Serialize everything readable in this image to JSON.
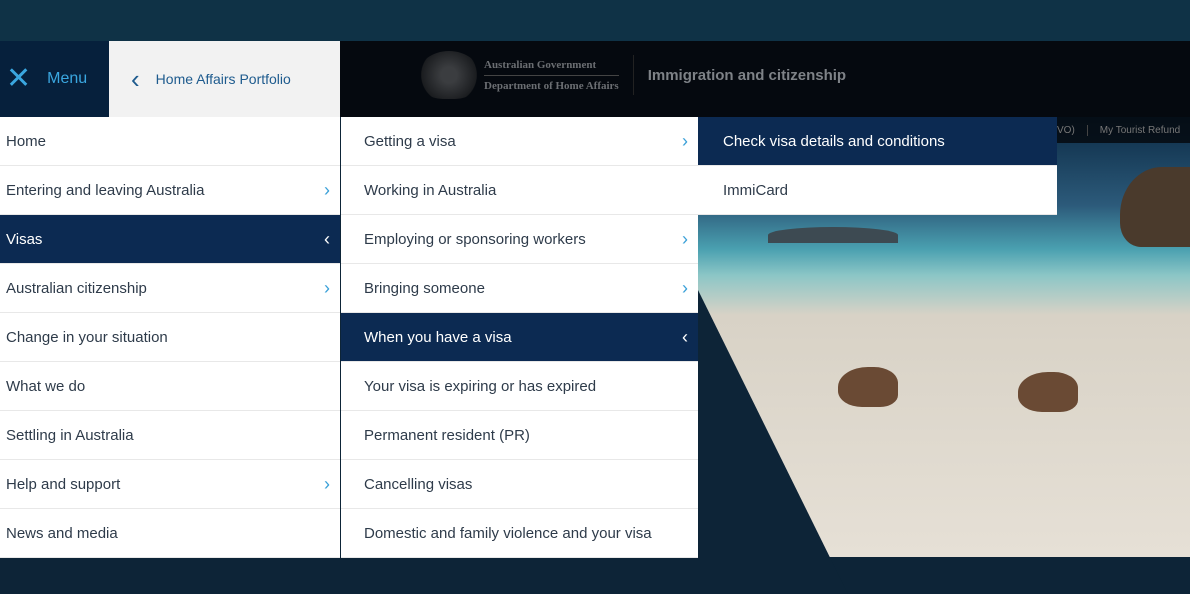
{
  "header": {
    "menu_label": "Menu",
    "portfolio_label": "Home Affairs Portfolio",
    "gov_line1": "Australian Government",
    "gov_line2": "Department of Home Affairs",
    "site_title": "Immigration and citizenship"
  },
  "top_links": [
    "VO)",
    "My Tourist Refund"
  ],
  "col1": [
    {
      "label": "Home",
      "chev": ""
    },
    {
      "label": "Entering and leaving Australia",
      "chev": "›"
    },
    {
      "label": "Visas",
      "chev": "‹",
      "sel": true
    },
    {
      "label": "Australian citizenship",
      "chev": "›"
    },
    {
      "label": "Change in your situation",
      "chev": ""
    },
    {
      "label": "What we do",
      "chev": ""
    },
    {
      "label": "Settling in Australia",
      "chev": ""
    },
    {
      "label": "Help and support",
      "chev": "›"
    },
    {
      "label": "News and media",
      "chev": ""
    }
  ],
  "col2": [
    {
      "label": "Getting a visa",
      "chev": "›"
    },
    {
      "label": "Working in Australia",
      "chev": ""
    },
    {
      "label": "Employing or sponsoring workers",
      "chev": "›"
    },
    {
      "label": "Bringing someone",
      "chev": "›"
    },
    {
      "label": "When you have a visa",
      "chev": "‹",
      "sel": true
    },
    {
      "label": "Your visa is expiring or has expired",
      "chev": ""
    },
    {
      "label": "Permanent resident (PR)",
      "chev": ""
    },
    {
      "label": "Cancelling visas",
      "chev": ""
    },
    {
      "label": "Domestic and family violence and your visa",
      "chev": ""
    }
  ],
  "col3": [
    {
      "label": "Check visa details and conditions",
      "chev": "",
      "sel": true
    },
    {
      "label": "ImmiCard",
      "chev": ""
    }
  ],
  "colors": {
    "selected": "#0c2a52",
    "chevron": "#3aa0d8",
    "menu_text": "#3aa7e0"
  }
}
